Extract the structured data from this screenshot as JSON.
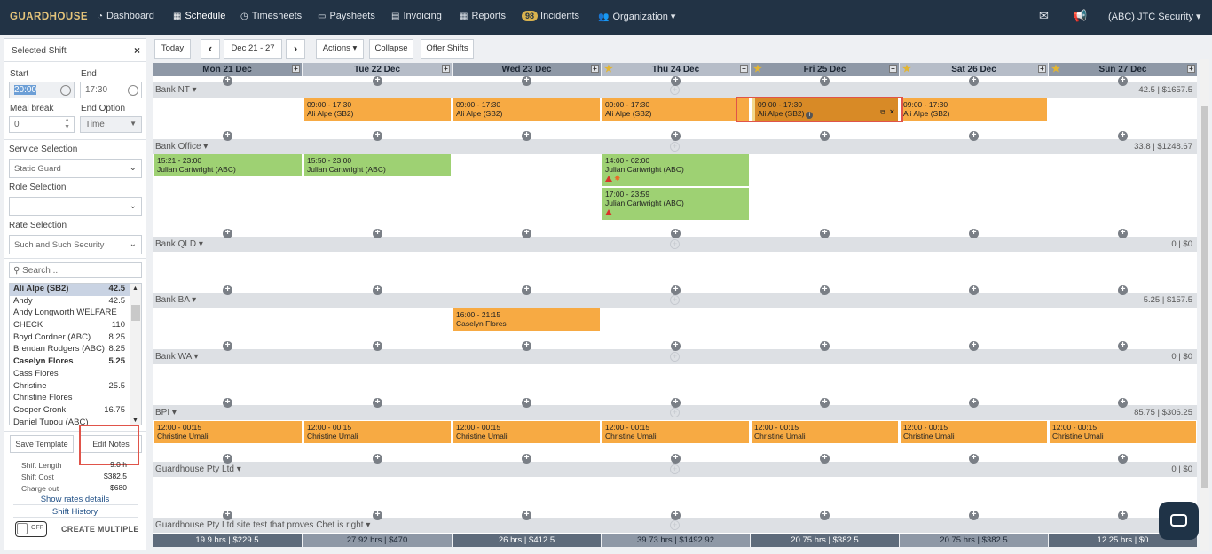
{
  "nav": {
    "logo": "GUARDHOUSE",
    "items": [
      "Dashboard",
      "Schedule",
      "Timesheets",
      "Paysheets",
      "Invoicing",
      "Reports",
      "Incidents",
      "Organization"
    ],
    "incidents_badge": "98",
    "user": "(ABC) JTC Security",
    "user_caret": "▾",
    "org_caret": "▾"
  },
  "panel": {
    "title": "Selected Shift",
    "close": "×",
    "start_label": "Start",
    "start_value": "20:00",
    "end_label": "End",
    "end_value": "17:30",
    "meal_label": "Meal break",
    "meal_value": "0",
    "end_option_label": "End Option",
    "end_option_value": "Time",
    "service_label": "Service Selection",
    "service_value": "Static Guard",
    "role_label": "Role Selection",
    "role_value": "",
    "rate_label": "Rate Selection",
    "rate_value": "Such and Such Security",
    "search_placeholder": "Search ...",
    "staff": [
      {
        "name": "Ali Alpe (SB2)",
        "amount": "42.5"
      },
      {
        "name": "Andy",
        "amount": "42.5"
      },
      {
        "name": "Andy Longworth WELFARE",
        "amount": ""
      },
      {
        "name": "CHECK",
        "amount": "110"
      },
      {
        "name": "Boyd Cordner (ABC)",
        "amount": "8.25"
      },
      {
        "name": "Brendan Rodgers (ABC)",
        "amount": "8.25"
      },
      {
        "name": "Caselyn Flores",
        "amount": "5.25"
      },
      {
        "name": "Cass Flores",
        "amount": ""
      },
      {
        "name": "Christine",
        "amount": "25.5"
      },
      {
        "name": "Christine Flores",
        "amount": ""
      },
      {
        "name": "Cooper Cronk",
        "amount": "16.75"
      },
      {
        "name": "Daniel Tupou (ABC)",
        "amount": ""
      }
    ],
    "save_template": "Save Template",
    "edit_notes": "Edit Notes",
    "shift_length_label": "Shift Length",
    "shift_length_value": "9.0 h",
    "shift_cost_label": "Shift Cost",
    "shift_cost_value": "$382.5",
    "charge_out_label": "Charge out",
    "charge_out_value": "$680",
    "show_rates": "Show rates details",
    "shift_history": "Shift History",
    "toggle_text": "OFF",
    "create_multiple": "CREATE MULTIPLE"
  },
  "toolbar": {
    "today": "Today",
    "prev": "‹",
    "range": "Dec 21 - 27",
    "next": "›",
    "actions": "Actions ▾",
    "collapse": "Collapse",
    "offer": "Offer Shifts"
  },
  "days": [
    {
      "label": "Mon 21 Dec"
    },
    {
      "label": "Tue 22 Dec"
    },
    {
      "label": "Wed 23 Dec"
    },
    {
      "label": "Thu 24 Dec"
    },
    {
      "label": "Fri 25 Dec"
    },
    {
      "label": "Sat 26 Dec"
    },
    {
      "label": "Sun 27 Dec"
    }
  ],
  "groups": [
    {
      "name": "Bank NT ▾",
      "total": "42.5 | $1657.5"
    },
    {
      "name": "Bank Office ▾",
      "total": "33.8 | $1248.67"
    },
    {
      "name": "Bank QLD ▾",
      "total": "0 | $0"
    },
    {
      "name": "Bank BA ▾",
      "total": "5.25 | $157.5"
    },
    {
      "name": "Bank WA ▾",
      "total": "0 | $0"
    },
    {
      "name": "BPI ▾",
      "total": "85.75 | $306.25"
    },
    {
      "name": "Guardhouse Pty Ltd ▾",
      "total": "0 | $0"
    },
    {
      "name": "Guardhouse Pty Ltd site test that proves Chet is right ▾",
      "total": ""
    }
  ],
  "shifts": {
    "nt_time": "09:00 - 17:30",
    "nt_name": "Ali Alpe (SB2)",
    "off1_time": "15:21 - 23:00",
    "off1_name": "Julian Cartwright (ABC)",
    "off2_time": "15:50 - 23:00",
    "off2_name": "Julian Cartwright (ABC)",
    "off3_time": "14:00 - 02:00",
    "off3_name": "Julian Cartwright (ABC)",
    "off4_time": "17:00 - 23:59",
    "off4_name": "Julian Cartwright (ABC)",
    "ba_time": "16:00 - 21:15",
    "ba_name": "Caselyn Flores",
    "bpi_time": "12:00 - 00:15",
    "bpi_name": "Christine Umali"
  },
  "footer": [
    "19.9 hrs  | $229.5",
    "27.92 hrs  | $470",
    "26 hrs  | $412.5",
    "39.73 hrs  | $1492.92",
    "20.75 hrs  | $382.5",
    "20.75 hrs  | $382.5",
    "12.25 hrs  | $0"
  ],
  "colors": {
    "nav": "#223345",
    "orange": "#f7aa43",
    "green": "#9ed173",
    "highlight": "#e0544a"
  }
}
